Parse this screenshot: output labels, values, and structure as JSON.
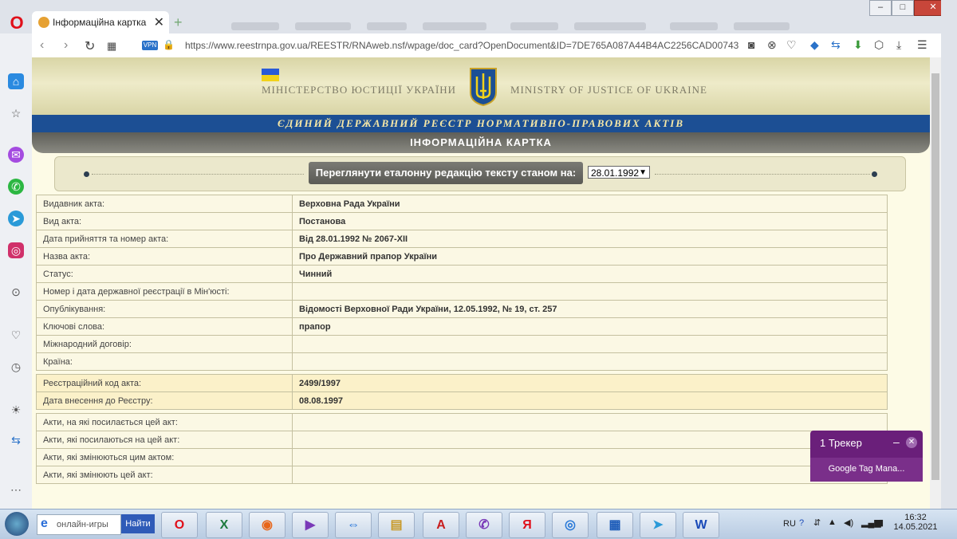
{
  "browser": {
    "tab_title": "Інформаційна картка",
    "url": "https://www.reestrnpa.gov.ua/REESTR/RNAweb.nsf/wpage/doc_card?OpenDocument&ID=7DE765A087A44B4AC2256CAD00743",
    "vpn_label": "VPN",
    "close_glyph": "✕",
    "newtab_glyph": "+",
    "win_min": "–",
    "win_max": "□",
    "win_close": "✕"
  },
  "header": {
    "ministry_ua": "МІНІСТЕРСТВО ЮСТИЦІЇ УКРАЇНИ",
    "ministry_en": "MINISTRY OF JUSTICE OF UKRAINE",
    "registry_title": "ЄДИНИЙ ДЕРЖАВНИЙ РЕЄСТР НОРМАТИВНО-ПРАВОВИХ АКТІВ",
    "card_title": "ІНФОРМАЦІЙНА КАРТКА"
  },
  "selector": {
    "button_label": "Переглянути еталонну редакцію тексту станом на:",
    "selected_date": "28.01.1992"
  },
  "table_main": [
    {
      "key": "Видавник акта:",
      "value": "Верховна Рада України"
    },
    {
      "key": "Вид акта:",
      "value": "Постанова"
    },
    {
      "key": "Дата прийняття та номер акта:",
      "value": "Від 28.01.1992 № 2067-XII"
    },
    {
      "key": "Назва акта:",
      "value": "Про Державний прапор України"
    },
    {
      "key": "Статус:",
      "value": "Чинний"
    },
    {
      "key": "Номер і дата державної реєстрації в Мін'юсті:",
      "value": ""
    },
    {
      "key": "Опублікування:",
      "value": "Відомості Верховної Ради України, 12.05.1992, № 19, ст. 257"
    },
    {
      "key": "Ключові слова:",
      "value": "прапор"
    },
    {
      "key": "Міжнародний договір:",
      "value": ""
    },
    {
      "key": "Країна:",
      "value": ""
    }
  ],
  "table_registration": [
    {
      "key": "Реєстраційний код акта:",
      "value": "2499/1997"
    },
    {
      "key": "Дата внесення до Реєстру:",
      "value": "08.08.1997"
    }
  ],
  "table_links": [
    {
      "key": "Акти, на які посилається цей акт:",
      "value": ""
    },
    {
      "key": "Акти, які посилаються на цей акт:",
      "value": ""
    },
    {
      "key": "Акти, які змінюються цим актом:",
      "value": ""
    },
    {
      "key": "Акти, які змінюють цей акт:",
      "value": ""
    }
  ],
  "tracker": {
    "title": "1 Трекер",
    "item": "Google Tag Mana..."
  },
  "taskbar": {
    "search_text": "онлайн-игры",
    "find_button": "Найти",
    "lang": "RU",
    "time": "16:32",
    "date": "14.05.2021"
  }
}
